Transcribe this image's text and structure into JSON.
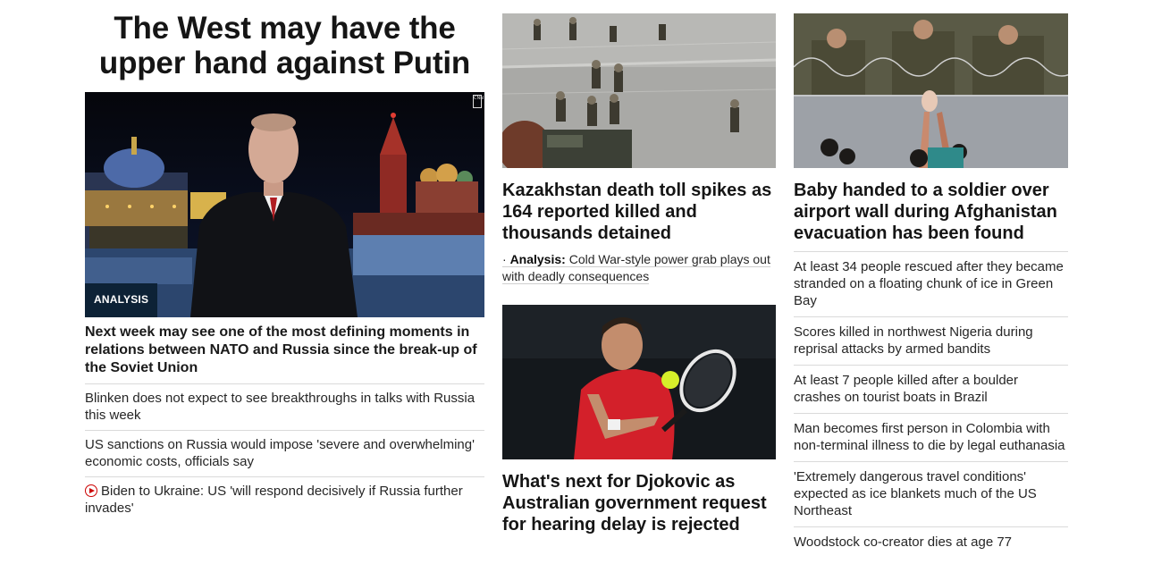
{
  "col1": {
    "headline": "The West may have the upper hand against Putin",
    "badge": "ANALYSIS",
    "description": "Next week may see one of the most defining moments in relations between NATO and Russia since the break-up of the Soviet Union",
    "related": [
      "Blinken does not expect to see breakthroughs in talks with Russia this week",
      "US sanctions on Russia would impose 'severe and overwhelming' economic costs, officials say",
      "Biden to Ukraine: US 'will respond decisively if Russia further invades'"
    ]
  },
  "col2": {
    "story1": {
      "headline": "Kazakhstan death toll spikes as 164 reported killed and thousands detained",
      "analysis_label": "Analysis:",
      "analysis_text": "Cold War-style power grab plays out with deadly consequences"
    },
    "story2": {
      "headline": "What's next for Djokovic as Australian government request for hearing delay is rejected"
    }
  },
  "col3": {
    "headline": "Baby handed to a soldier over airport wall during Afghanistan evacuation has been found",
    "list": [
      "At least 34 people rescued after they became stranded on a floating chunk of ice in Green Bay",
      "Scores killed in northwest Nigeria during reprisal attacks by armed bandits",
      "At least 7 people killed after a boulder crashes on tourist boats in Brazil",
      "Man becomes first person in Colombia with non-terminal illness to die by legal euthanasia",
      "'Extremely dangerous travel conditions' expected as ice blankets much of the US Northeast",
      "Woodstock co-creator dies at age 77"
    ]
  },
  "colors": {
    "badge_bg": "#0d2236",
    "video_icon": "#cc0000",
    "divider": "#dadada"
  },
  "icons": {
    "video": "play-circle-icon",
    "network_bug": "CNN"
  }
}
